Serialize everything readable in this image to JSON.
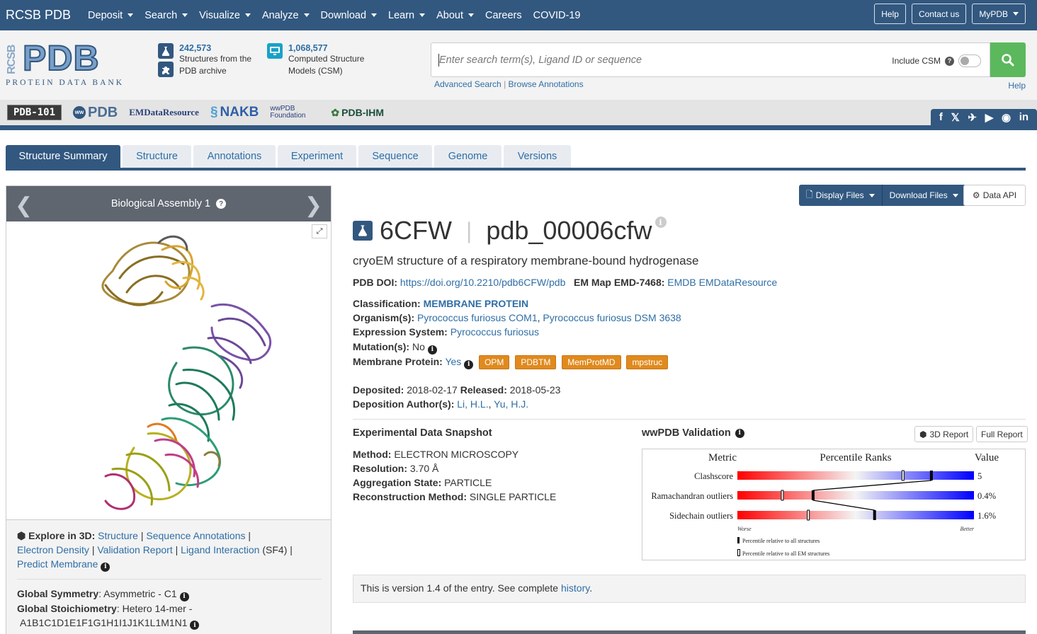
{
  "topnav": {
    "brand": "RCSB PDB",
    "items": [
      "Deposit",
      "Search",
      "Visualize",
      "Analyze",
      "Download",
      "Learn",
      "About"
    ],
    "careers": "Careers",
    "covid": "COVID-19",
    "help": "Help",
    "contact": "Contact us",
    "mypdb": "MyPDB"
  },
  "header": {
    "logo_side": "RCSB",
    "logo_main": "PDB",
    "logo_name": "PROTEIN DATA BANK",
    "stat1": {
      "number": "242,573",
      "line1": "Structures from the",
      "line2": "PDB archive"
    },
    "stat2": {
      "number": "1,068,577",
      "line1": "Computed Structure",
      "line2": "Models (CSM)"
    },
    "search_placeholder": "Enter search term(s), Ligand ID or sequence",
    "include_csm": "Include CSM",
    "advanced_search": "Advanced Search",
    "browse_annotations": "Browse Annotations",
    "help": "Help"
  },
  "partners": [
    "PDB-101",
    "PDB",
    "EMDataResource",
    "NAKB",
    "wwPDB Foundation",
    "PDB-IHM"
  ],
  "tabs": [
    "Structure Summary",
    "Structure",
    "Annotations",
    "Experiment",
    "Sequence",
    "Genome",
    "Versions"
  ],
  "viewer": {
    "title": "Biological Assembly 1"
  },
  "explore": {
    "label": "Explore in 3D",
    "structure": "Structure",
    "seq_annotations": "Sequence Annotations",
    "electron_density": "Electron Density",
    "validation_report": "Validation Report",
    "ligand_interaction": "Ligand Interaction",
    "ligand_id": "(SF4)",
    "predict_membrane": "Predict Membrane"
  },
  "symmetry": {
    "global_symmetry_label": "Global Symmetry",
    "global_symmetry_value": "Asymmetric - C1",
    "global_stoich_label": "Global Stoichiometry",
    "global_stoich_value": "Hetero 14-mer -",
    "stoich_chains": "A1B1C1D1E1F1G1H1I1J1K1L1M1N1"
  },
  "actions": {
    "display_files": "Display Files",
    "download_files": "Download Files",
    "data_api": "Data API"
  },
  "entry": {
    "id": "6CFW",
    "ext_id": "pdb_00006cfw",
    "title": "cryoEM structure of a respiratory membrane-bound hydrogenase",
    "doi_label": "PDB DOI:",
    "doi": "https://doi.org/10.2210/pdb6CFW/pdb",
    "emmap_label": "EM Map EMD-7468:",
    "emdb": "EMDB",
    "emdr": "EMDataResource",
    "classification_label": "Classification:",
    "classification": "MEMBRANE PROTEIN",
    "organism_label": "Organism(s):",
    "organism1": "Pyrococcus furiosus COM1",
    "organism2": "Pyrococcus furiosus DSM 3638",
    "expression_label": "Expression System:",
    "expression": "Pyrococcus furiosus",
    "mutation_label": "Mutation(s):",
    "mutation": "No",
    "membrane_label": "Membrane Protein:",
    "membrane": "Yes",
    "membrane_badges": [
      "OPM",
      "PDBTM",
      "MemProtMD",
      "mpstruc"
    ],
    "deposited_label": "Deposited:",
    "deposited": "2018-02-17",
    "released_label": "Released:",
    "released": "2018-05-23",
    "authors_label": "Deposition Author(s):",
    "author1": "Li, H.L.",
    "author2": "Yu, H.J."
  },
  "snapshot": {
    "title": "Experimental Data Snapshot",
    "method_label": "Method:",
    "method": "ELECTRON MICROSCOPY",
    "resolution_label": "Resolution:",
    "resolution": "3.70 Å",
    "aggregation_label": "Aggregation State:",
    "aggregation": "PARTICLE",
    "recon_label": "Reconstruction Method:",
    "recon": "SINGLE PARTICLE"
  },
  "validation": {
    "title": "wwPDB Validation",
    "report3d": "3D Report",
    "full_report": "Full Report",
    "col_metric": "Metric",
    "col_percentile": "Percentile Ranks",
    "col_value": "Value",
    "worse": "Worse",
    "better": "Better",
    "legend_all": "Percentile relative to all structures",
    "legend_em": "Percentile relative to all EM structures",
    "metrics": [
      {
        "name": "Clashscore",
        "value": "5",
        "pct_all": 0.82,
        "pct_em": 0.7
      },
      {
        "name": "Ramachandran outliers",
        "value": "0.4%",
        "pct_all": 0.32,
        "pct_em": 0.19
      },
      {
        "name": "Sidechain outliers",
        "value": "1.6%",
        "pct_all": 0.58,
        "pct_em": 0.3
      }
    ]
  },
  "version": {
    "text": "This is version 1.4 of the entry. See complete",
    "link": "history",
    "end": "."
  },
  "colors": {
    "nav": "#325880",
    "link": "#2f6ea5",
    "badge": "#e08a1e",
    "search_btn": "#5cb85c"
  }
}
